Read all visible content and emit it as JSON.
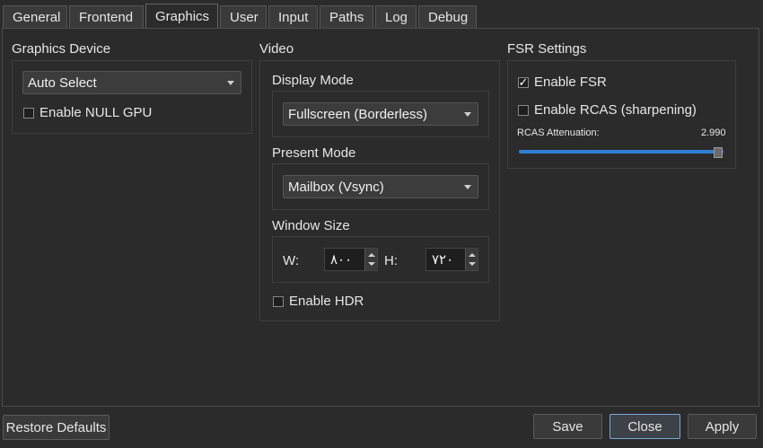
{
  "tabs": [
    {
      "label": "General"
    },
    {
      "label": "Frontend"
    },
    {
      "label": "Graphics"
    },
    {
      "label": "User"
    },
    {
      "label": "Input"
    },
    {
      "label": "Paths"
    },
    {
      "label": "Log"
    },
    {
      "label": "Debug"
    }
  ],
  "active_tab": "Graphics",
  "graphics_device": {
    "title": "Graphics Device",
    "device_value": "Auto Select",
    "null_gpu_label": "Enable NULL GPU",
    "null_gpu_checked": false
  },
  "video": {
    "title": "Video",
    "display_mode_title": "Display Mode",
    "display_mode_value": "Fullscreen (Borderless)",
    "present_mode_title": "Present Mode",
    "present_mode_value": "Mailbox (Vsync)",
    "window_size_title": "Window Size",
    "width_label": "W:",
    "width_value": "٨٠٠",
    "height_label": "H:",
    "height_value": "٧٢٠",
    "hdr_label": "Enable HDR",
    "hdr_checked": false
  },
  "fsr": {
    "title": "FSR Settings",
    "enable_fsr_label": "Enable FSR",
    "enable_fsr_checked": true,
    "rcas_label": "Enable RCAS (sharpening)",
    "rcas_checked": false,
    "attenuation_label": "RCAS Attenuation:",
    "attenuation_value": "2.990",
    "attenuation_level_fraction": 0.997
  },
  "footer": {
    "restore_label": "Restore Defaults",
    "save_label": "Save",
    "close_label": "Close",
    "apply_label": "Apply"
  },
  "colors": {
    "background": "#2b2b2b",
    "accent": "#2f7fd6",
    "text": "#e6e6e6"
  }
}
